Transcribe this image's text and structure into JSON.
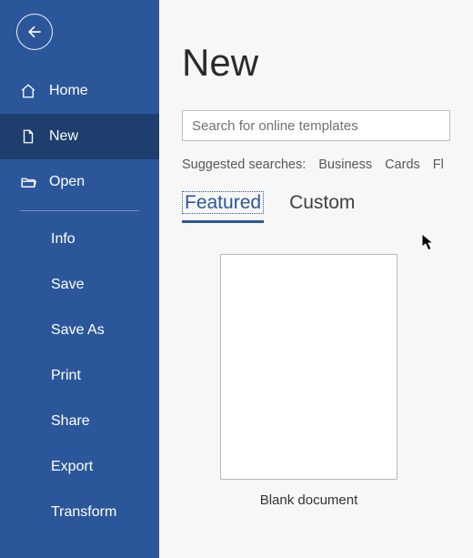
{
  "sidebar": {
    "home": "Home",
    "new": "New",
    "open": "Open",
    "sub": [
      "Info",
      "Save",
      "Save As",
      "Print",
      "Share",
      "Export",
      "Transform"
    ]
  },
  "main": {
    "title": "New",
    "search_placeholder": "Search for online templates",
    "suggested_label": "Suggested searches:",
    "suggested": [
      "Business",
      "Cards",
      "Fl"
    ],
    "tabs": {
      "featured": "Featured",
      "custom": "Custom"
    },
    "template_label": "Blank document"
  }
}
